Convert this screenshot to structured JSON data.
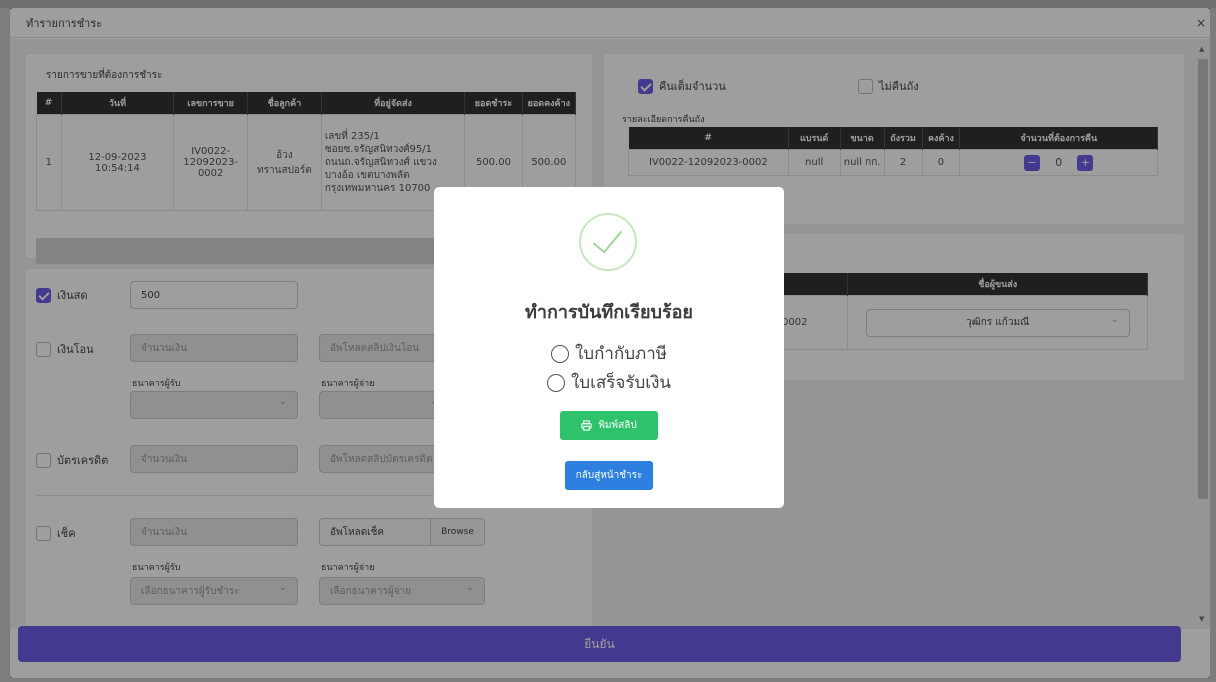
{
  "modal": {
    "title": "ทำรายการชำระ",
    "close_icon": "×"
  },
  "sales": {
    "title": "รายการขายที่ต้องการชำระ",
    "headers": [
      "#",
      "วันที่",
      "เลขการขาย",
      "ชื่อลูกค้า",
      "ที่อยู่จัดส่ง",
      "ยอดชำระ",
      "ยอดคงค้าง"
    ],
    "rows": [
      {
        "no": "1",
        "date": "12-09-2023 10:54:14",
        "sale_no": "IV0022-12092023-0002",
        "customer": "อ้วง ทรานสปอร์ต",
        "address": "เลขที่ 235/1 ซอยซ.จรัญสนิทวงศ์95/1 ถนนถ.จรัญสนิทวงศ์ แขวงบางอ้อ เขตบางพลัด กรุงเทพมหานคร 10700",
        "pay": "500.00",
        "outstanding": "500.00"
      }
    ]
  },
  "payment": {
    "cash": {
      "label": "เงินสด",
      "value": "500"
    },
    "transfer": {
      "label": "เงินโอน",
      "placeholder": "จำนวนเงิน",
      "upload": "อัพโหลดสลิปเงินโอน",
      "bank_recv": "ธนาคารผู้รับ",
      "bank_pay": "ธนาคารผู้จ่าย"
    },
    "credit": {
      "label": "บัตรเครดิต",
      "placeholder": "จำนวนเงิน",
      "upload": "อัพโหลดสลิปบัตรเครดิต"
    },
    "cheque": {
      "label": "เช็ค",
      "placeholder": "จำนวนเงิน",
      "upload": "อัพโหลดเช็ค",
      "browse": "Browse",
      "bank_recv": "ธนาคารผู้รับ",
      "bank_pay": "ธนาคารผู้จ่าย",
      "bank_recv_select": "เลือกธนาคารผู้รับชำระ",
      "bank_pay_select": "เลือกธนาคารผู้จ่าย"
    }
  },
  "returns": {
    "full_return": "คืนเต็มจำนวน",
    "no_return": "ไม่คืนถัง",
    "detail_title": "รายละเอียดการคืนถัง",
    "headers": [
      "#",
      "แบรนด์",
      "ขนาด",
      "ถังรวม",
      "คงค้าง",
      "จำนวนที่ต้องการคืน"
    ],
    "rows": [
      {
        "id": "IV0022-12092023-0002",
        "brand": "null",
        "size": "null กก.",
        "total": "2",
        "remaining": "0",
        "qty": "0"
      }
    ]
  },
  "delivery": {
    "header_name": "ชื่อผู้ขนส่ง",
    "row_id_fragment": "0002",
    "driver": "วุฒิกร แก้วมณี"
  },
  "confirm_label": "ยืนยัน",
  "dialog": {
    "title": "ทำการบันทึกเรียบร้อย",
    "option_tax": "ใบกำกับภาษี",
    "option_receipt": "ใบเสร็จรับเงิน",
    "print_label": "พิมพ์สลิป",
    "back_label": "กลับสู่หน้าชำระ"
  },
  "colors": {
    "primary": "#6c5ce7",
    "success": "#2ec26a",
    "info": "#2d7fe0"
  },
  "icons": {
    "print": "printer-icon",
    "check": "check-circle-icon"
  }
}
